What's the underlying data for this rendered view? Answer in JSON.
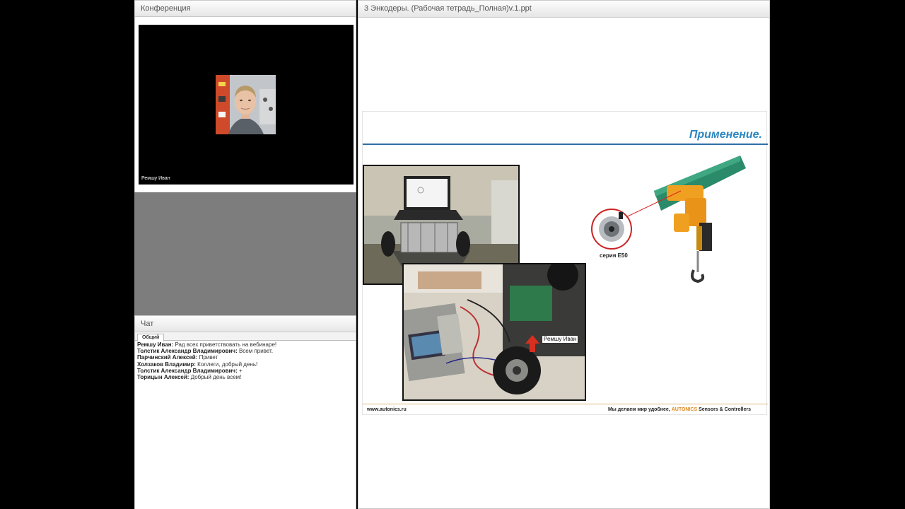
{
  "conference": {
    "title": "Конференция",
    "video_name": "Ремшу Иван"
  },
  "chat": {
    "title": "Чат",
    "tab_label": "Общий",
    "messages": [
      {
        "author": "Ремшу Иван:",
        "text": " Рад всех приветствовать на вебинаре!"
      },
      {
        "author": "Толстик Александр  Владимирович:",
        "text": " Всем привет."
      },
      {
        "author": "Парчинский Алексей:",
        "text": " Привет"
      },
      {
        "author": "Холзаков  Владимир:",
        "text": " Коллеги, добрый день!"
      },
      {
        "author": "Толстик Александр  Владимирович:",
        "text": " +"
      },
      {
        "author": "Торицын Алексей:",
        "text": " Добрый день всем!"
      }
    ]
  },
  "presentation": {
    "title": "3 Энкодеры. (Рабочая тетрадь_Полная)v.1.ppt",
    "slide": {
      "heading": "Применение.",
      "photo_label": "Ремшу Иван",
      "series_label": "серия E50",
      "footer_url": "www.autonics.ru",
      "footer_slogan": "Мы делаем мир удобнее, ",
      "footer_brand": "AUTONICS",
      "footer_suffix": " Sensors & Controllers"
    }
  },
  "colors": {
    "heading": "#2b86c0",
    "brand": "#e08a1a",
    "crane": "#f0a020",
    "rail": "#2a8a6a"
  }
}
